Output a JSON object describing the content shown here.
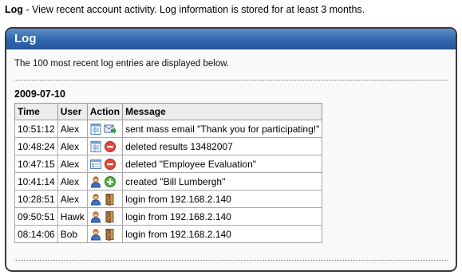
{
  "intro": {
    "title": "Log",
    "text": " - View recent account activity. Log information is stored for at least 3 months."
  },
  "panel": {
    "title": "Log",
    "description": "The 100 most recent log entries are displayed below."
  },
  "log": {
    "date": "2009-07-10",
    "columns": [
      "Time",
      "User",
      "Action",
      "Message"
    ],
    "rows": [
      {
        "time": "10:51:12",
        "user": "Alex",
        "icons": [
          "report-icon",
          "email-send-icon"
        ],
        "message": "sent mass email \"Thank you for participating!\""
      },
      {
        "time": "10:48:24",
        "user": "Alex",
        "icons": [
          "report-icon",
          "delete-icon"
        ],
        "message": "deleted results 13482007"
      },
      {
        "time": "10:47:15",
        "user": "Alex",
        "icons": [
          "form-icon",
          "delete-icon"
        ],
        "message": "deleted \"Employee Evaluation\""
      },
      {
        "time": "10:41:14",
        "user": "Alex",
        "icons": [
          "user-icon",
          "add-icon"
        ],
        "message": "created \"Bill Lumbergh\""
      },
      {
        "time": "10:28:51",
        "user": "Alex",
        "icons": [
          "user-icon",
          "door-icon"
        ],
        "message": "login from 192.168.2.140"
      },
      {
        "time": "09:50:51",
        "user": "Hawk",
        "icons": [
          "user-icon",
          "door-icon"
        ],
        "message": "login from 192.168.2.140"
      },
      {
        "time": "08:14:06",
        "user": "Bob",
        "icons": [
          "user-icon",
          "door-icon"
        ],
        "message": "login from 192.168.2.140"
      }
    ]
  }
}
